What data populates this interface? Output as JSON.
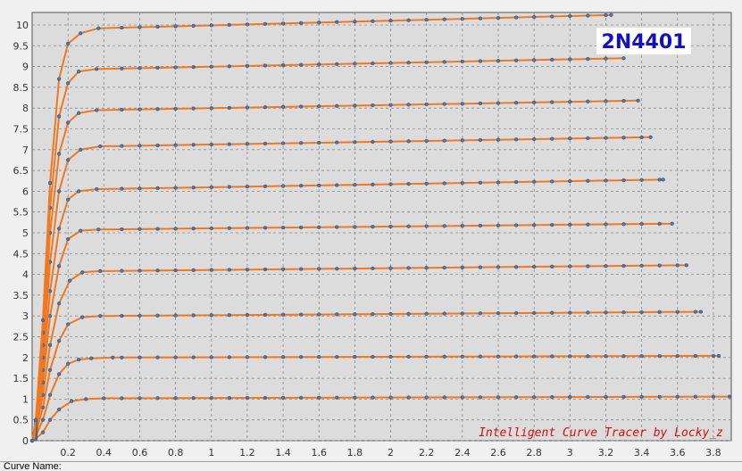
{
  "annotations": {
    "part_label": "2N4401",
    "credit": "Intelligent Curve Tracer by Locky_z"
  },
  "status": {
    "curve_name_label": "Curve Name:"
  },
  "colors": {
    "plot_bg": "#dcdcdc",
    "grid": "#8a8a8a",
    "curve": "#f07820",
    "marker": "#4a78b0",
    "part_label_box": "#ffffff",
    "credit_text": "#d01010"
  },
  "chart_data": {
    "type": "line",
    "title": "",
    "xlabel": "",
    "ylabel": "",
    "xlim": [
      0,
      3.9
    ],
    "ylim": [
      0,
      10.3
    ],
    "grid": true,
    "x_ticks": [
      {
        "label": "0.2",
        "value": 0.2
      },
      {
        "label": "0.4",
        "value": 0.4
      },
      {
        "label": "0.6",
        "value": 0.6
      },
      {
        "label": "0.8",
        "value": 0.8
      },
      {
        "label": "1",
        "value": 1.0
      },
      {
        "label": "1.2",
        "value": 1.2
      },
      {
        "label": "1.4",
        "value": 1.4
      },
      {
        "label": "1.6",
        "value": 1.6
      },
      {
        "label": "1.8",
        "value": 1.8
      },
      {
        "label": "2",
        "value": 2.0
      },
      {
        "label": "2.2",
        "value": 2.2
      },
      {
        "label": "2.4",
        "value": 2.4
      },
      {
        "label": "2.6",
        "value": 2.6
      },
      {
        "label": "2.8",
        "value": 2.8
      },
      {
        "label": "3",
        "value": 3.0
      },
      {
        "label": "3.2",
        "value": 3.2
      },
      {
        "label": "3.4",
        "value": 3.4
      },
      {
        "label": "3.6",
        "value": 3.6
      },
      {
        "label": "3.8",
        "value": 3.8
      }
    ],
    "y_ticks": [
      {
        "label": "0",
        "value": 0
      },
      {
        "label": "0.5",
        "value": 0.5
      },
      {
        "label": "1",
        "value": 1
      },
      {
        "label": "1.5",
        "value": 1.5
      },
      {
        "label": "2",
        "value": 2
      },
      {
        "label": "2.5",
        "value": 2.5
      },
      {
        "label": "3",
        "value": 3
      },
      {
        "label": "3.5",
        "value": 3.5
      },
      {
        "label": "4",
        "value": 4
      },
      {
        "label": "4.5",
        "value": 4.5
      },
      {
        "label": "5",
        "value": 5
      },
      {
        "label": "5.5",
        "value": 5.5
      },
      {
        "label": "6",
        "value": 6
      },
      {
        "label": "6.5",
        "value": 6.5
      },
      {
        "label": "7",
        "value": 7
      },
      {
        "label": "7.5",
        "value": 7.5
      },
      {
        "label": "8",
        "value": 8
      },
      {
        "label": "8.5",
        "value": 8.5
      },
      {
        "label": "9",
        "value": 9
      },
      {
        "label": "9.5",
        "value": 9.5
      },
      {
        "label": "10",
        "value": 10
      }
    ],
    "series": [
      {
        "points": [
          [
            0,
            0
          ],
          [
            0.02,
            0.05
          ],
          [
            0.06,
            0.2
          ],
          [
            0.1,
            0.5
          ],
          [
            0.15,
            0.75
          ],
          [
            0.22,
            0.95
          ],
          [
            0.3,
            1.0
          ],
          [
            0.4,
            1.02
          ],
          [
            3.89,
            1.06
          ]
        ]
      },
      {
        "points": [
          [
            0,
            0
          ],
          [
            0.02,
            0.1
          ],
          [
            0.06,
            0.5
          ],
          [
            0.1,
            1.1
          ],
          [
            0.15,
            1.6
          ],
          [
            0.2,
            1.85
          ],
          [
            0.26,
            1.95
          ],
          [
            0.33,
            1.98
          ],
          [
            0.45,
            2.0
          ],
          [
            3.83,
            2.04
          ]
        ]
      },
      {
        "points": [
          [
            0,
            0
          ],
          [
            0.02,
            0.15
          ],
          [
            0.06,
            0.8
          ],
          [
            0.1,
            1.7
          ],
          [
            0.15,
            2.4
          ],
          [
            0.2,
            2.8
          ],
          [
            0.28,
            2.97
          ],
          [
            0.38,
            3.0
          ],
          [
            3.73,
            3.1
          ]
        ]
      },
      {
        "points": [
          [
            0,
            0
          ],
          [
            0.02,
            0.2
          ],
          [
            0.06,
            1.1
          ],
          [
            0.1,
            2.3
          ],
          [
            0.15,
            3.3
          ],
          [
            0.21,
            3.85
          ],
          [
            0.28,
            4.05
          ],
          [
            0.38,
            4.08
          ],
          [
            3.65,
            4.22
          ]
        ]
      },
      {
        "points": [
          [
            0,
            0
          ],
          [
            0.02,
            0.25
          ],
          [
            0.06,
            1.4
          ],
          [
            0.1,
            3.0
          ],
          [
            0.15,
            4.2
          ],
          [
            0.2,
            4.85
          ],
          [
            0.27,
            5.05
          ],
          [
            0.37,
            5.08
          ],
          [
            3.57,
            5.22
          ]
        ]
      },
      {
        "points": [
          [
            0,
            0
          ],
          [
            0.02,
            0.3
          ],
          [
            0.06,
            1.7
          ],
          [
            0.1,
            3.6
          ],
          [
            0.15,
            5.1
          ],
          [
            0.2,
            5.8
          ],
          [
            0.26,
            6.0
          ],
          [
            0.36,
            6.05
          ],
          [
            3.52,
            6.28
          ]
        ]
      },
      {
        "points": [
          [
            0,
            0
          ],
          [
            0.02,
            0.35
          ],
          [
            0.06,
            2.0
          ],
          [
            0.1,
            4.3
          ],
          [
            0.15,
            6.0
          ],
          [
            0.2,
            6.75
          ],
          [
            0.27,
            7.0
          ],
          [
            0.38,
            7.08
          ],
          [
            3.45,
            7.3
          ]
        ]
      },
      {
        "points": [
          [
            0,
            0
          ],
          [
            0.02,
            0.4
          ],
          [
            0.06,
            2.3
          ],
          [
            0.1,
            5.0
          ],
          [
            0.15,
            6.9
          ],
          [
            0.2,
            7.65
          ],
          [
            0.26,
            7.88
          ],
          [
            0.36,
            7.95
          ],
          [
            3.38,
            8.18
          ]
        ]
      },
      {
        "points": [
          [
            0,
            0
          ],
          [
            0.02,
            0.45
          ],
          [
            0.06,
            2.6
          ],
          [
            0.1,
            5.6
          ],
          [
            0.15,
            7.8
          ],
          [
            0.2,
            8.6
          ],
          [
            0.26,
            8.88
          ],
          [
            0.36,
            8.94
          ],
          [
            3.3,
            9.2
          ]
        ]
      },
      {
        "points": [
          [
            0,
            0
          ],
          [
            0.02,
            0.5
          ],
          [
            0.06,
            2.9
          ],
          [
            0.1,
            6.2
          ],
          [
            0.15,
            8.7
          ],
          [
            0.2,
            9.55
          ],
          [
            0.27,
            9.8
          ],
          [
            0.37,
            9.92
          ],
          [
            3.23,
            10.24
          ]
        ]
      }
    ]
  }
}
